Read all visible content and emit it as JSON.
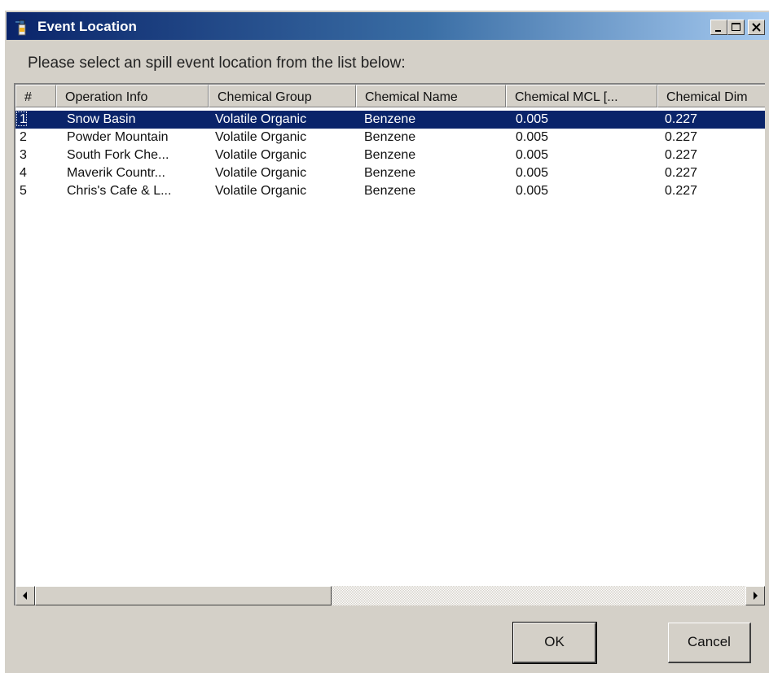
{
  "window": {
    "title": "Event Location",
    "prompt": "Please select an spill event location from the list below:"
  },
  "icons": {
    "app": "spray-bottle-icon",
    "minimize": "minimize-icon",
    "maximize": "maximize-icon",
    "close": "close-icon",
    "scroll_left": "arrow-left-icon",
    "scroll_right": "arrow-right-icon"
  },
  "list": {
    "columns": [
      "#",
      "Operation Info",
      "Chemical Group",
      "Chemical Name",
      "Chemical MCL [...",
      "Chemical Dim"
    ],
    "rows": [
      {
        "num": "1",
        "operation": "Snow Basin",
        "group": "Volatile Organic",
        "name": "Benzene",
        "mcl": "0.005",
        "dim": "0.227"
      },
      {
        "num": "2",
        "operation": "Powder Mountain",
        "group": "Volatile Organic",
        "name": "Benzene",
        "mcl": "0.005",
        "dim": "0.227"
      },
      {
        "num": "3",
        "operation": "South Fork Che...",
        "group": "Volatile Organic",
        "name": "Benzene",
        "mcl": "0.005",
        "dim": "0.227"
      },
      {
        "num": "4",
        "operation": "Maverik Countr...",
        "group": "Volatile Organic",
        "name": "Benzene",
        "mcl": "0.005",
        "dim": "0.227"
      },
      {
        "num": "5",
        "operation": "Chris's Cafe & L...",
        "group": "Volatile Organic",
        "name": "Benzene",
        "mcl": "0.005",
        "dim": "0.227"
      }
    ],
    "selected_row": "1"
  },
  "buttons": {
    "ok": "OK",
    "cancel": "Cancel"
  },
  "colors": {
    "selection": "#0a246a",
    "titlebar_start": "#0a246a",
    "titlebar_end": "#a6caf0",
    "face": "#d4d0c8"
  }
}
